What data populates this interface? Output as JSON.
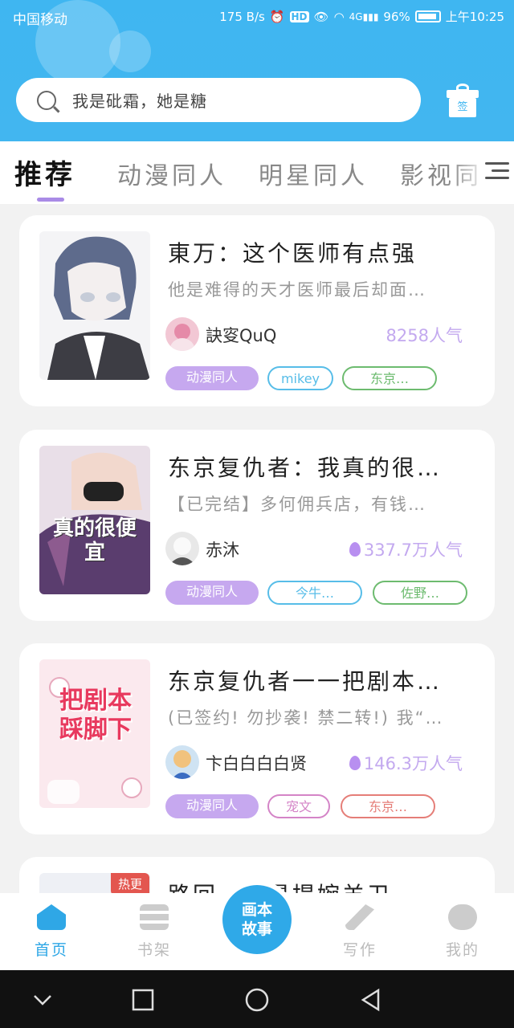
{
  "status_bar": {
    "carrier": "中国移动",
    "speed": "175 B/s",
    "battery": "96%",
    "time": "上午10:25"
  },
  "search": {
    "placeholder": "我是砒霜，她是糖",
    "gift_label": "签"
  },
  "tabs": [
    {
      "label": "推荐",
      "active": true
    },
    {
      "label": "动漫同人",
      "active": false
    },
    {
      "label": "明星同人",
      "active": false
    },
    {
      "label": "影视同",
      "active": false
    }
  ],
  "cards": [
    {
      "title": "東万：这个医师有点强",
      "desc": "他是难得的天才医师最后却面…",
      "author": "訣叜QuQ",
      "popularity": "8258人气",
      "hot": false,
      "tags": [
        {
          "label": "动漫同人",
          "style": "main"
        },
        {
          "label": "mikey",
          "style": "blue"
        },
        {
          "label": "东京…",
          "style": "green"
        }
      ]
    },
    {
      "title": "东京复仇者：我真的很…",
      "desc": "【已完结】多何佣兵店，有钱…",
      "author": "赤沐",
      "popularity": "337.7万人气",
      "hot": true,
      "cover_text": "真的很便宜",
      "tags": [
        {
          "label": "动漫同人",
          "style": "main"
        },
        {
          "label": "今牛…",
          "style": "blue"
        },
        {
          "label": "佐野…",
          "style": "green"
        }
      ]
    },
    {
      "title": "东京复仇者一一把剧本…",
      "desc": "(已签约! 勿抄袭! 禁二转!) 我“…",
      "author": "卞白白白白贤",
      "popularity": "146.3万人气",
      "hot": true,
      "cover_text": "把剧本踩脚下",
      "tags": [
        {
          "label": "动漫同人",
          "style": "main"
        },
        {
          "label": "宠文",
          "style": "pink"
        },
        {
          "label": "东京…",
          "style": "red"
        }
      ]
    },
    {
      "title": "路回……是提婉羊卫",
      "badge": "热更"
    }
  ],
  "bottom_nav": {
    "items": [
      {
        "label": "首页",
        "active": true
      },
      {
        "label": "书架",
        "active": false
      },
      {
        "label": "写作",
        "active": false
      },
      {
        "label": "我的",
        "active": false
      }
    ],
    "center_label_line1": "画本",
    "center_label_line2": "故事"
  },
  "colors": {
    "header_blue": "#3fb6f1",
    "accent_purple": "#a98be6",
    "tag_purple": "#c6a8ef",
    "nav_active": "#2fa7e6"
  }
}
